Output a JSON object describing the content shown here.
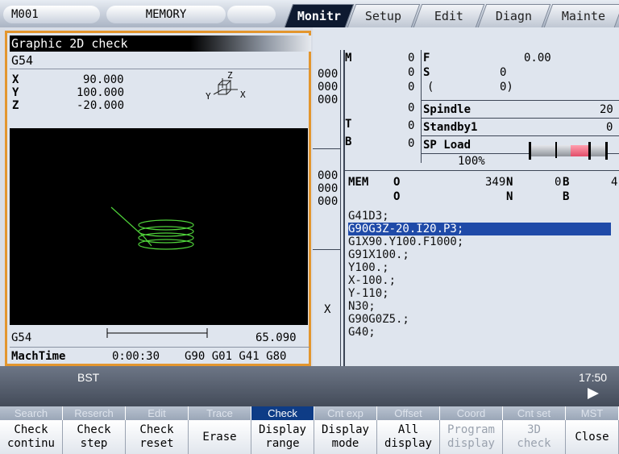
{
  "status": {
    "mode_code": "M001",
    "mode": "MEMORY"
  },
  "tabs": [
    "Monitr",
    "Setup",
    "Edit",
    "Diagn",
    "Mainte"
  ],
  "graphic": {
    "title": "Graphic 2D check",
    "wcs": "G54",
    "axes": [
      {
        "name": "X",
        "value": "90.000"
      },
      {
        "name": "Y",
        "value": "100.000"
      },
      {
        "name": "Z",
        "value": "-20.000"
      }
    ],
    "axis_icon_labels": {
      "z": "Z",
      "x": "X",
      "y": "Y"
    },
    "bottom_wcs": "G54",
    "scale_value": "65.090",
    "mach_time_label": "MachTime",
    "mach_time": "0:00:30",
    "modal": "G90 G01 G41 G80"
  },
  "right": {
    "left_col": [
      "000",
      "000",
      "000",
      "000",
      "000",
      "000",
      "X"
    ],
    "m_label": "M",
    "t_label": "T",
    "b_label": "B",
    "m_zeros": [
      "0",
      "0",
      "0",
      "0",
      "0",
      "0"
    ],
    "f_label": "F",
    "f_value": "0.00",
    "s_label": "S",
    "s_value": "0",
    "paren_open": "(",
    "paren_value": "0)",
    "spindle_label": "Spindle",
    "spindle_value": "20",
    "standby_label": "Standby1",
    "standby_value": "0",
    "spload_label": "SP Load",
    "spload_pct": "100%",
    "mem_label": "MEM",
    "o_label": "O",
    "o_value": "349",
    "n_label": "N",
    "n_value": "0",
    "b2_label": "B",
    "b2_value": "4",
    "program_lines": [
      "G41D3;",
      "G90G3Z-20.I20.P3;",
      "G1X90.Y100.F1000;",
      "G91X100.;",
      "Y100.;",
      "X-100.;",
      "Y-110;",
      "N30;",
      "G90G0Z5.;",
      "G40;"
    ],
    "highlight_index": 1
  },
  "bst": {
    "label": "BST",
    "time": "17:50"
  },
  "menu_heads": [
    "Search",
    "Reserch",
    "Edit",
    "Trace",
    "Check",
    "Cnt exp",
    "Offset",
    "Coord",
    "Cnt set",
    "MST"
  ],
  "menu_buttons": [
    [
      "Check",
      "continu"
    ],
    [
      "Check",
      "step"
    ],
    [
      "Check",
      "reset"
    ],
    [
      "Erase"
    ],
    [
      "Display",
      "range"
    ],
    [
      "Display",
      "mode"
    ],
    [
      "All",
      "display"
    ],
    [
      "Program",
      "display"
    ],
    [
      "3D",
      "check"
    ],
    [
      "Close"
    ]
  ],
  "colors": {
    "accent": "#e3962e",
    "highlight": "#1f4aa8",
    "trace": "#4fd23a"
  }
}
